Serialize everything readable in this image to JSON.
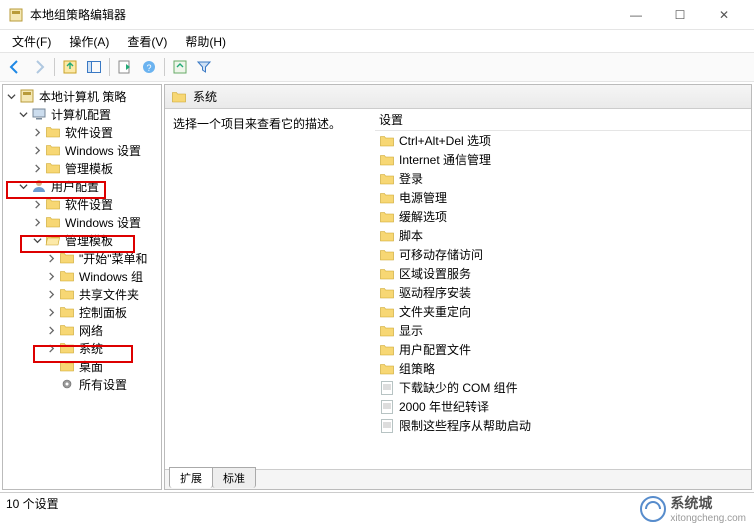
{
  "window": {
    "title": "本地组策略编辑器",
    "minimize": "—",
    "maximize": "☐",
    "close": "✕"
  },
  "menu": {
    "file": "文件(F)",
    "action": "操作(A)",
    "view": "查看(V)",
    "help": "帮助(H)"
  },
  "tree": {
    "root": "本地计算机 策略",
    "computer": "计算机配置",
    "c_software": "软件设置",
    "c_windows": "Windows 设置",
    "c_templates": "管理模板",
    "user": "用户配置",
    "u_software": "软件设置",
    "u_windows": "Windows 设置",
    "u_templates": "管理模板",
    "start_menu": "\"开始\"菜单和",
    "windows_comp": "Windows 组",
    "shared_folders": "共享文件夹",
    "control_panel": "控制面板",
    "network": "网络",
    "system": "系统",
    "desktop": "桌面",
    "all_settings": "所有设置"
  },
  "content": {
    "header": "系统",
    "description": "选择一个项目来查看它的描述。",
    "column_setting": "设置",
    "items": [
      "Ctrl+Alt+Del 选项",
      "Internet 通信管理",
      "登录",
      "电源管理",
      "缓解选项",
      "脚本",
      "可移动存储访问",
      "区域设置服务",
      "驱动程序安装",
      "文件夹重定向",
      "显示",
      "用户配置文件",
      "组策略",
      "下载缺少的 COM 组件",
      "2000 年世纪转译",
      "限制这些程序从帮助启动"
    ]
  },
  "tabs": {
    "extended": "扩展",
    "standard": "标准"
  },
  "status": {
    "text": "10 个设置"
  },
  "watermark": {
    "brand": "系统城",
    "url": "xitongcheng.com"
  }
}
